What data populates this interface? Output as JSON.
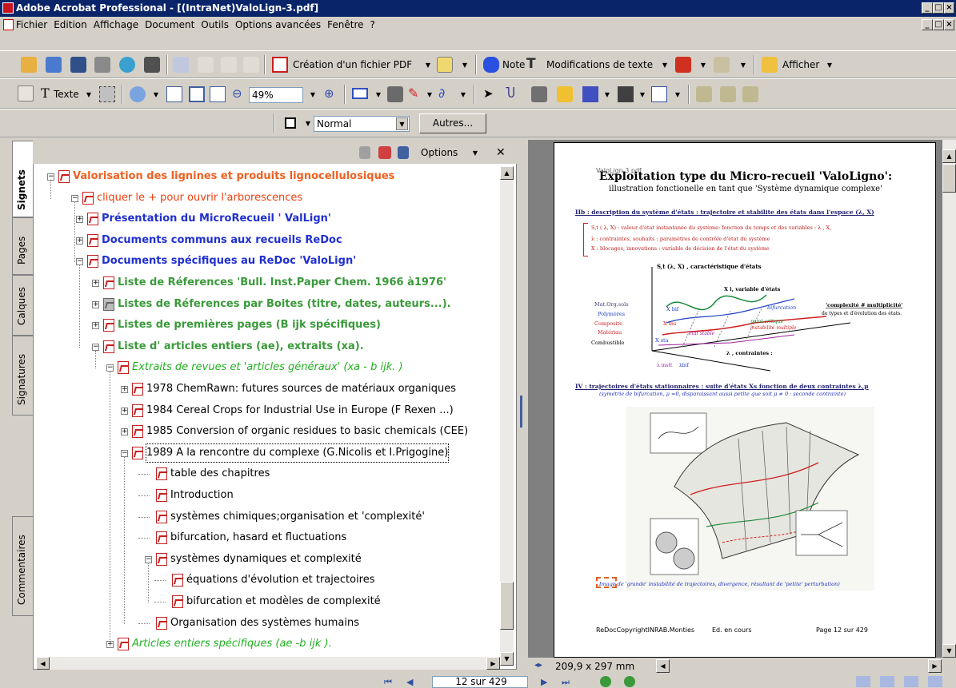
{
  "window": {
    "title": "Adobe Acrobat Professional - [(IntraNet)ValoLign-3.pdf]"
  },
  "menu": [
    "Fichier",
    "Edition",
    "Affichage",
    "Document",
    "Outils",
    "Options avancées",
    "Fenêtre",
    "?"
  ],
  "toolbar1": {
    "create_pdf": "Création d'un fichier PDF",
    "note": "Note",
    "text_edits": "Modifications de texte",
    "show": "Afficher"
  },
  "toolbar2": {
    "text_tool": "Texte",
    "zoom": "49%"
  },
  "toolbar3": {
    "style": "Normal",
    "others": "Autres..."
  },
  "side_tabs": [
    "Signets",
    "Pages",
    "Calques",
    "Signatures",
    "Commentaires"
  ],
  "nav": {
    "options": "Options"
  },
  "tree": [
    {
      "label": "Valorisation des lignines et produits lignocellulosiques",
      "level": 0,
      "color": "orange",
      "exp": "minus"
    },
    {
      "label": "cliquer le + pour ouvrir l'arborescences",
      "level": 1,
      "color": "orange2",
      "exp": "minus"
    },
    {
      "label": "Présentation du MicroRecueil ' ValLign'",
      "level": 2,
      "color": "blue",
      "exp": "plus"
    },
    {
      "label": "Documents communs aux recueils ReDoc",
      "level": 2,
      "color": "blue",
      "exp": "plus"
    },
    {
      "label": "Documents spécifiques au ReDoc 'ValoLign'",
      "level": 2,
      "color": "blue",
      "exp": "minus"
    },
    {
      "label": "Liste de Réferences 'Bull. Inst.Paper Chem. 1966 à1976'",
      "level": 3,
      "color": "green",
      "exp": "plus"
    },
    {
      "label": "Listes de Réferences par Boites (titre, dates, auteurs...).",
      "level": 3,
      "color": "green",
      "exp": "plus",
      "gray": true
    },
    {
      "label": "Listes de premières pages (B ijk spécifiques)",
      "level": 3,
      "color": "green",
      "exp": "plus"
    },
    {
      "label": "Liste d' articles entiers (ae), extraits (xa).",
      "level": 3,
      "color": "green",
      "exp": "minus"
    },
    {
      "label": "Extraits de revues et 'articles généraux' (xa - b ijk. )",
      "level": 4,
      "color": "greeni",
      "exp": "minus"
    },
    {
      "label": "1978 ChemRawn: futures sources de matériaux organiques",
      "level": 5,
      "color": "black",
      "exp": "plus"
    },
    {
      "label": "1984 Cereal Crops for Industrial Use in Europe (F Rexen ...)",
      "level": 5,
      "color": "black",
      "exp": "plus"
    },
    {
      "label": "1985 Conversion of  organic residues to basic chemicals (CEE)",
      "level": 5,
      "color": "black",
      "exp": "plus"
    },
    {
      "label": "1989 A la rencontre du complexe (G.Nicolis et I.Prigogine)",
      "level": 5,
      "color": "black",
      "exp": "minus",
      "selected": true
    },
    {
      "label": "table des chapitres",
      "level": 6,
      "color": "black",
      "exp": "none"
    },
    {
      "label": "Introduction",
      "level": 6,
      "color": "black",
      "exp": "none"
    },
    {
      "label": "systèmes chimiques;organisation et 'complexité'",
      "level": 6,
      "color": "black",
      "exp": "none"
    },
    {
      "label": "bifurcation, hasard et fluctuations",
      "level": 6,
      "color": "black",
      "exp": "none"
    },
    {
      "label": "systèmes dynamiques et complexité",
      "level": 6,
      "color": "black",
      "exp": "minus"
    },
    {
      "label": "équations d'évolution et trajectoires",
      "level": 7,
      "color": "black",
      "exp": "none"
    },
    {
      "label": "bifurcation et modèles de complexité",
      "level": 7,
      "color": "black",
      "exp": "none"
    },
    {
      "label": "Organisation des systèmes humains",
      "level": 6,
      "color": "black",
      "exp": "none"
    },
    {
      "label": "Articles entiers  spécifiques (ae -b ijk ).",
      "level": 4,
      "color": "greeni",
      "exp": "plus"
    }
  ],
  "document": {
    "header_small": "ValoLign 3 pdf",
    "title": "Exploitation type du Micro-recueil  'ValoLigno':",
    "subtitle": "illustration fonctionelle  en  tant  que  'Système dynamique complexe'",
    "section2": "IIb  : description du système d'états : trajectoire et stabilite des états dans l'espace (λ, X)",
    "def1": "S,t ( λ, X) : valeur d'état instantanée du système: fonction du temps et des variables : λ , X,",
    "def2": "λ : contraintes, souhaits : paramètres de contrôle d'état du système",
    "def3": "X : blocages, innovations : variable de décision de l'état du système",
    "section4": "IV : trajectoires d'états stationnaires : suite d'états Xs fonction de deux contraintes λ,μ",
    "section4b": "(symétrie de bifurcation, μ =0, disparaissant aussi petite que soit μ ≠ 0 : seconde contrainte)",
    "caption": "Image de 'grande' instabilité de trajectoires, divergence, résultant de 'petite' perturbation)",
    "footer_left": "ReDocCopyrightINRAB.Monties",
    "footer_mid": "Ed. en cours",
    "footer_right": "Page 12 sur 429",
    "labels": [
      "Mat.Org.sols",
      "Polymères",
      "Composite",
      "Matériau",
      "Combustible",
      "X bif",
      "X ins",
      "X sta",
      "λ instt",
      "λbif"
    ],
    "chart_labels": {
      "s_axis": "S,t (λ, X) , caractéristique d'états",
      "x_axis": "X i, variable d'états",
      "lambda_axis": "λ , contraintes :",
      "complexity": "'complexité # multiplicité'",
      "complexity2": "de types et d'évolution des états.",
      "bifurcation": "bifurcation",
      "critical": "point critique",
      "unstable": "instabilité multiple",
      "stable": "état stable"
    }
  },
  "doc_status": {
    "size": "209,9 x 297 mm"
  },
  "bottom": {
    "page": "12 sur 429"
  },
  "colors": {
    "titlebar": "#0a246a",
    "chrome": "#d4d0c8",
    "orange": "#f06020",
    "blue": "#2030d0",
    "green": "#3a9a3a",
    "pdf_red": "#c81e1e"
  }
}
